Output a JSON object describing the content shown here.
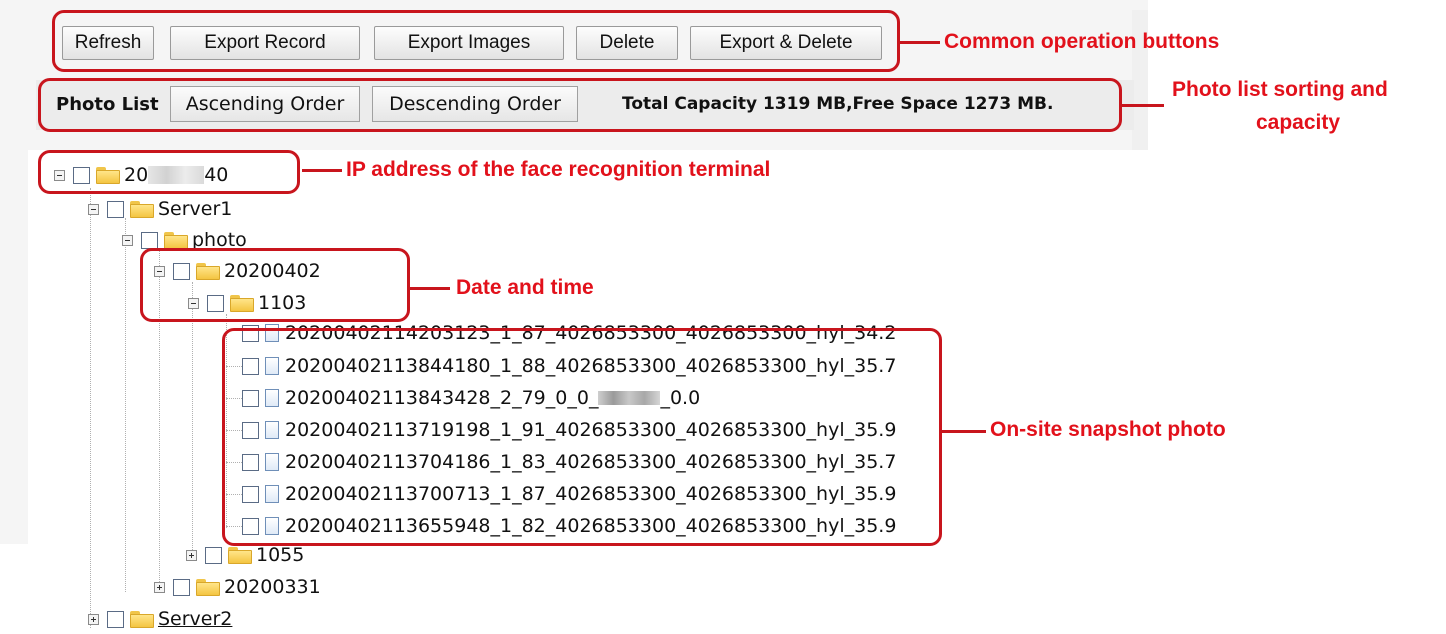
{
  "toolbar": {
    "refresh_label": "Refresh",
    "export_record_label": "Export Record",
    "export_images_label": "Export Images",
    "delete_label": "Delete",
    "export_delete_label": "Export & Delete"
  },
  "photo_list": {
    "label": "Photo List",
    "ascending_label": "Ascending Order",
    "descending_label": "Descending Order",
    "capacity_text": "Total Capacity  1319  MB,Free Space  1273  MB."
  },
  "tree": {
    "terminal": {
      "prefix": "20",
      "suffix": "40"
    },
    "server1": "Server1",
    "photo": "photo",
    "date_folder": "20200402",
    "time_folder": "1103",
    "files": [
      "20200402114203123_1_87_4026853300_4026853300_hyl_34.2",
      "20200402113844180_1_88_4026853300_4026853300_hyl_35.7",
      "20200402113843428_2_79_0_0_",
      "20200402113719198_1_91_4026853300_4026853300_hyl_35.9",
      "20200402113704186_1_83_4026853300_4026853300_hyl_35.7",
      "20200402113700713_1_87_4026853300_4026853300_hyl_35.9",
      "20200402113655948_1_82_4026853300_4026853300_hyl_35.9"
    ],
    "file3_suffix": "_0.0",
    "folder_1055": "1055",
    "folder_20200331": "20200331",
    "server2": "Server2"
  },
  "annotations": {
    "buttons": "Common operation buttons",
    "sorting_line1": "Photo list sorting and",
    "sorting_line2": "capacity",
    "ip": "IP address of the face recognition terminal",
    "date": "Date and time",
    "snapshot": "On-site snapshot photo"
  },
  "colors": {
    "annotation": "#e2111b",
    "annotation_border": "#c8151d",
    "folder": "#f4c542"
  },
  "icons": [
    "folder-icon",
    "file-icon",
    "expand-icon",
    "collapse-icon",
    "checkbox"
  ]
}
